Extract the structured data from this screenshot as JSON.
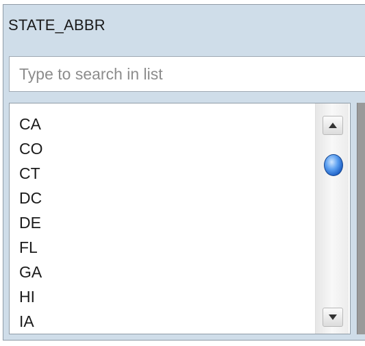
{
  "field": {
    "title": "STATE_ABBR"
  },
  "search": {
    "placeholder": "Type to search in list",
    "value": ""
  },
  "list": {
    "items": [
      "CA",
      "CO",
      "CT",
      "DC",
      "DE",
      "FL",
      "GA",
      "HI",
      "IA"
    ]
  },
  "scrollbar": {
    "up_icon": "arrow-up-icon",
    "down_icon": "arrow-down-icon",
    "thumb_icon": "scroll-thumb"
  }
}
